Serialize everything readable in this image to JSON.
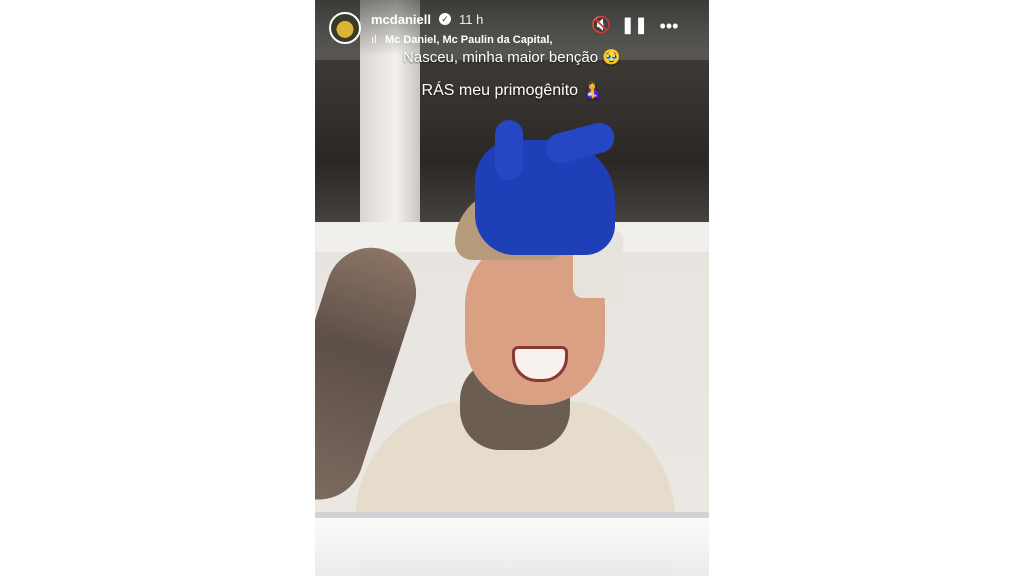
{
  "story": {
    "username": "mcdaniell",
    "verified_icon": "verified-check-icon",
    "time_ago": "11 h",
    "music_icon": "audio-waveform-icon",
    "music_artists": "Mc Daniel, Mc Paulin da Capital,",
    "caption_line1": "Nasceu, minha maior benção 🥹",
    "caption_line2": "RÁS meu primogênito 🤱",
    "controls": {
      "mute_icon": "🔇",
      "pause_icon": "❚❚",
      "more_icon": "•••"
    }
  },
  "colors": {
    "glove": "#1e3fb8",
    "overlay_text": "#ffffff",
    "page_background": "#ffffff"
  }
}
